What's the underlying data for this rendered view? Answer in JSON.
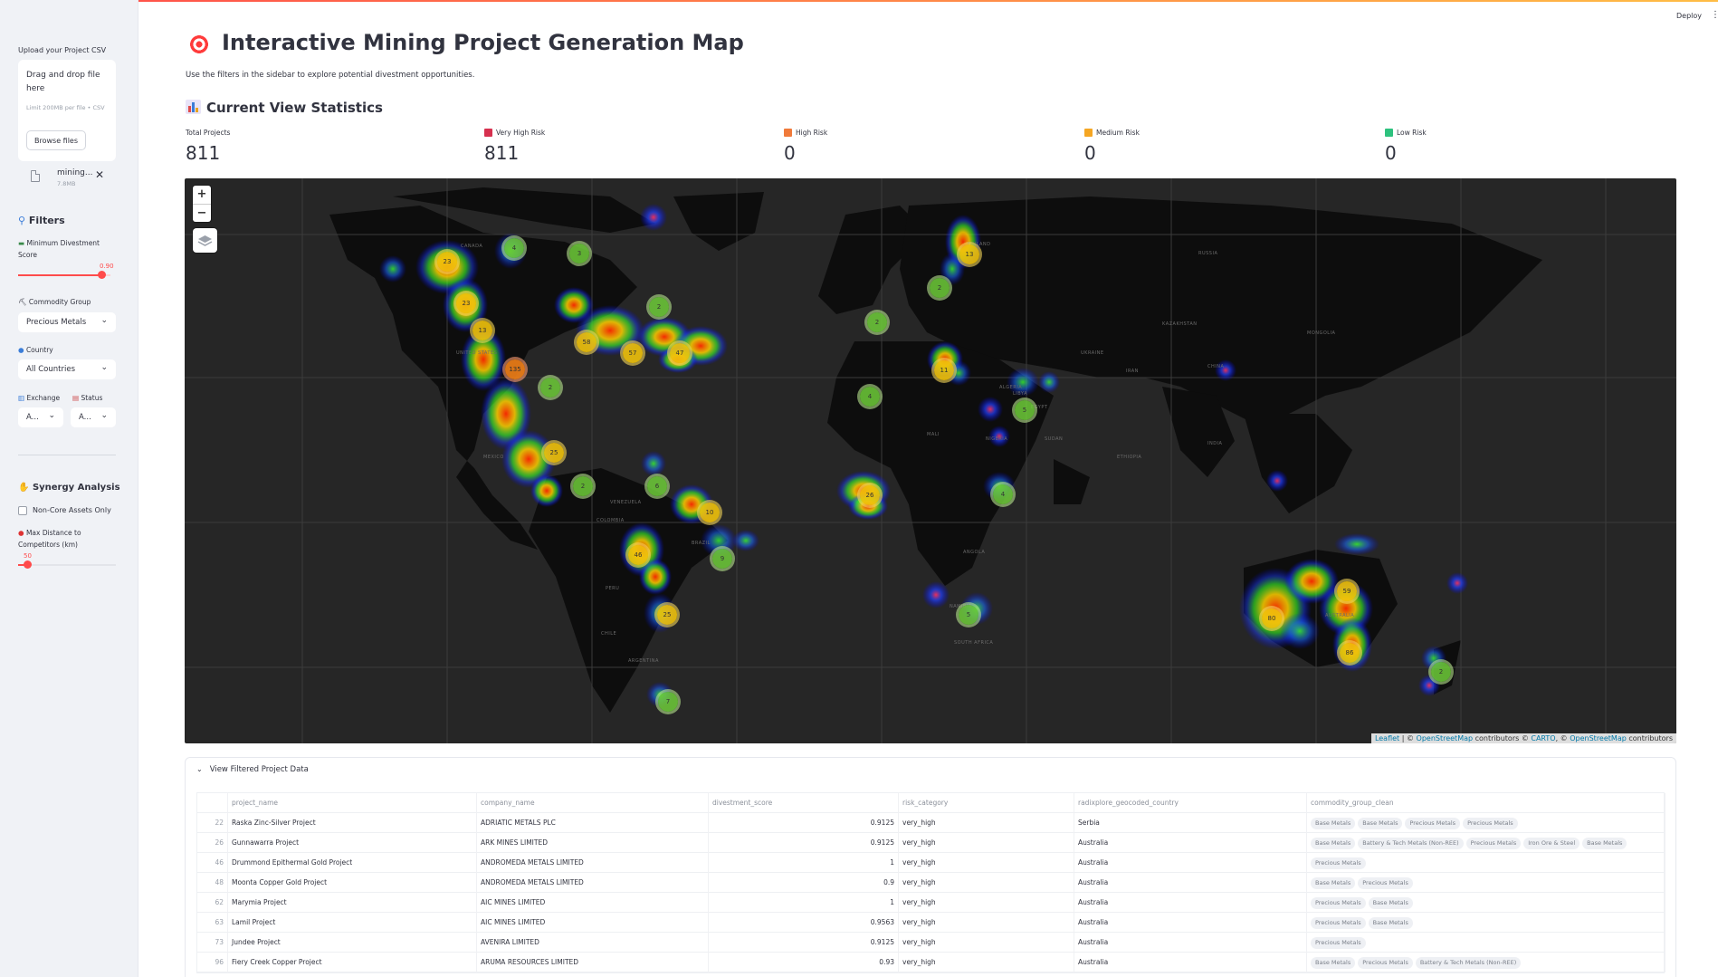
{
  "app": {
    "deploy_label": "Deploy",
    "menu_icon": "vertical-dots-icon"
  },
  "sidebar": {
    "upload_label": "Upload your Project CSV",
    "dropzone_text": "Drag and drop file here",
    "dropzone_limit": "Limit 200MB per file • CSV",
    "browse_label": "Browse files",
    "file_name": "mining...",
    "file_size": "7.8MB",
    "filters_title": "Filters",
    "min_score_label": "Minimum Divestment Score",
    "min_score_value": "0.90",
    "min_score_fraction": 0.9,
    "commodity_label": "Commodity Group",
    "commodity_value": "Precious Metals",
    "country_label": "Country",
    "country_value": "All Countries",
    "exchange_label": "Exchange",
    "exchange_value": "A...",
    "status_label": "Status",
    "status_value": "A...",
    "synergy_title": "Synergy Analysis",
    "noncore_label": "Non-Core Assets Only",
    "max_distance_label": "Max Distance to Competitors (km)",
    "max_distance_value": "50"
  },
  "header": {
    "title": "Interactive Mining Project Generation Map",
    "subtitle": "Use the filters in the sidebar to explore potential divestment opportunities.",
    "stats_title": "Current View Statistics"
  },
  "metrics": [
    {
      "label": "Total Projects",
      "value": "811",
      "color": ""
    },
    {
      "label": "Very High Risk",
      "value": "811",
      "color": "#d6304f"
    },
    {
      "label": "High Risk",
      "value": "0",
      "color": "#f07a3a"
    },
    {
      "label": "Medium Risk",
      "value": "0",
      "color": "#f5a623"
    },
    {
      "label": "Low Risk",
      "value": "0",
      "color": "#2ec27e"
    }
  ],
  "map": {
    "zoom_in": "+",
    "zoom_out": "−",
    "attribution_leaflet": "Leaflet",
    "attribution_osm": "OpenStreetMap",
    "attribution_contrib": "contributors ©",
    "attribution_carto": "CARTO",
    "attribution_osm2": "OpenStreetMap",
    "attribution_contrib2": "contributors",
    "labels": [
      "CANADA",
      "UNITED STATES",
      "MEXICO",
      "BRAZIL",
      "PERU",
      "ARGENTINA",
      "RUSSIA",
      "KAZAKHSTAN",
      "MONGOLIA",
      "CHINA",
      "INDIA",
      "ALGERIA",
      "NIGERIA",
      "ETHIOPIA",
      "ANGOLA",
      "NAMIBIA",
      "SOUTH AFRICA",
      "AUSTRALIA",
      "UKRAINE",
      "FINLAND",
      "EGYPT",
      "MALI",
      "CHILE",
      "VENEZUELA",
      "IRAN",
      "COLOMBIA",
      "LIBYA",
      "SUDAN"
    ],
    "clusters": [
      {
        "label": "23",
        "kind": "yellow"
      },
      {
        "label": "4",
        "kind": "green"
      },
      {
        "label": "3",
        "kind": "green"
      },
      {
        "label": "23",
        "kind": "yellow"
      },
      {
        "label": "13",
        "kind": "yellow"
      },
      {
        "label": "135",
        "kind": "orange"
      },
      {
        "label": "2",
        "kind": "green"
      },
      {
        "label": "25",
        "kind": "yellow"
      },
      {
        "label": "58",
        "kind": "yellow"
      },
      {
        "label": "57",
        "kind": "yellow"
      },
      {
        "label": "47",
        "kind": "yellow"
      },
      {
        "label": "2",
        "kind": "green"
      },
      {
        "label": "2",
        "kind": "green"
      },
      {
        "label": "6",
        "kind": "green"
      },
      {
        "label": "10",
        "kind": "yellow"
      },
      {
        "label": "46",
        "kind": "yellow"
      },
      {
        "label": "9",
        "kind": "green"
      },
      {
        "label": "25",
        "kind": "yellow"
      },
      {
        "label": "7",
        "kind": "green"
      },
      {
        "label": "13",
        "kind": "yellow"
      },
      {
        "label": "2",
        "kind": "green"
      },
      {
        "label": "2",
        "kind": "green"
      },
      {
        "label": "11",
        "kind": "yellow"
      },
      {
        "label": "4",
        "kind": "green"
      },
      {
        "label": "5",
        "kind": "green"
      },
      {
        "label": "26",
        "kind": "yellow"
      },
      {
        "label": "4",
        "kind": "green"
      },
      {
        "label": "5",
        "kind": "green"
      },
      {
        "label": "59",
        "kind": "yellow"
      },
      {
        "label": "80",
        "kind": "yellow"
      },
      {
        "label": "86",
        "kind": "yellow"
      },
      {
        "label": "2",
        "kind": "green"
      }
    ]
  },
  "table": {
    "expander_label": "View Filtered Project Data",
    "columns": [
      "project_name",
      "company_name",
      "divestment_score",
      "risk_category",
      "radixplore_geocoded_country",
      "commodity_group_clean"
    ],
    "rows": [
      {
        "idx": "22",
        "project": "Raska Zinc-Silver Project",
        "company": "ADRIATIC METALS PLC",
        "score": "0.9125",
        "risk": "very_high",
        "country": "Serbia",
        "tags": [
          "Base Metals",
          "Base Metals",
          "Precious Metals",
          "Precious Metals"
        ]
      },
      {
        "idx": "26",
        "project": "Gunnawarra Project",
        "company": "ARK MINES LIMITED",
        "score": "0.9125",
        "risk": "very_high",
        "country": "Australia",
        "tags": [
          "Base Metals",
          "Battery & Tech Metals (Non-REE)",
          "Precious Metals",
          "Iron Ore & Steel",
          "Base Metals"
        ]
      },
      {
        "idx": "46",
        "project": "Drummond Epithermal Gold Project",
        "company": "ANDROMEDA METALS LIMITED",
        "score": "1",
        "risk": "very_high",
        "country": "Australia",
        "tags": [
          "Precious Metals"
        ]
      },
      {
        "idx": "48",
        "project": "Moonta Copper Gold Project",
        "company": "ANDROMEDA METALS LIMITED",
        "score": "0.9",
        "risk": "very_high",
        "country": "Australia",
        "tags": [
          "Base Metals",
          "Precious Metals"
        ]
      },
      {
        "idx": "62",
        "project": "Marymia Project",
        "company": "AIC MINES LIMITED",
        "score": "1",
        "risk": "very_high",
        "country": "Australia",
        "tags": [
          "Precious Metals",
          "Base Metals"
        ]
      },
      {
        "idx": "63",
        "project": "Lamil Project",
        "company": "AIC MINES LIMITED",
        "score": "0.9563",
        "risk": "very_high",
        "country": "Australia",
        "tags": [
          "Precious Metals",
          "Base Metals"
        ]
      },
      {
        "idx": "73",
        "project": "Jundee Project",
        "company": "AVENIRA LIMITED",
        "score": "0.9125",
        "risk": "very_high",
        "country": "Australia",
        "tags": [
          "Precious Metals"
        ]
      },
      {
        "idx": "96",
        "project": "Fiery Creek Copper Project",
        "company": "ARUMA RESOURCES LIMITED",
        "score": "0.93",
        "risk": "very_high",
        "country": "Australia",
        "tags": [
          "Base Metals",
          "Precious Metals",
          "Battery & Tech Metals (Non-REE)"
        ]
      }
    ]
  },
  "icons": {
    "title": "target-icon",
    "stats": "bar-chart-icon",
    "filters": "magnifier-icon",
    "synergy": "handshake-icon"
  }
}
